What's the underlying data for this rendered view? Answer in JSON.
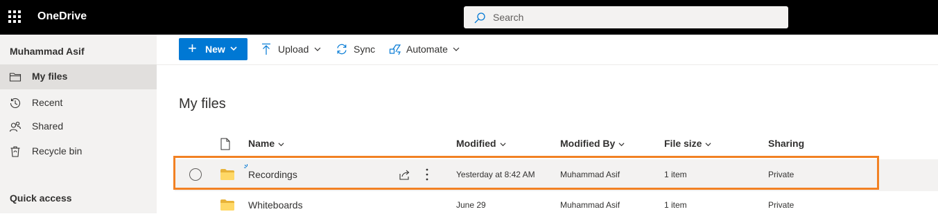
{
  "app": {
    "title": "OneDrive"
  },
  "search": {
    "placeholder": "Search"
  },
  "sidebar": {
    "user": "Muhammad Asif",
    "items": [
      {
        "label": "My files",
        "icon": "folder-icon",
        "active": true
      },
      {
        "label": "Recent",
        "icon": "history-icon"
      },
      {
        "label": "Shared",
        "icon": "people-icon"
      },
      {
        "label": "Recycle bin",
        "icon": "recycle-bin-icon"
      }
    ],
    "quick_access": "Quick access"
  },
  "toolbar": {
    "new_label": "New",
    "upload_label": "Upload",
    "sync_label": "Sync",
    "automate_label": "Automate"
  },
  "main": {
    "title": "My files",
    "columns": [
      "Name",
      "Modified",
      "Modified By",
      "File size",
      "Sharing"
    ],
    "rows": [
      {
        "name": "Recordings",
        "modified": "Yesterday at 8:42 AM",
        "modified_by": "Muhammad Asif",
        "size": "1 item",
        "sharing": "Private"
      },
      {
        "name": "Whiteboards",
        "modified": "June 29",
        "modified_by": "Muhammad Asif",
        "size": "1 item",
        "sharing": "Private"
      }
    ]
  },
  "colors": {
    "accent": "#0078d4",
    "highlight": "#f28123",
    "folder": "#ffd866"
  }
}
